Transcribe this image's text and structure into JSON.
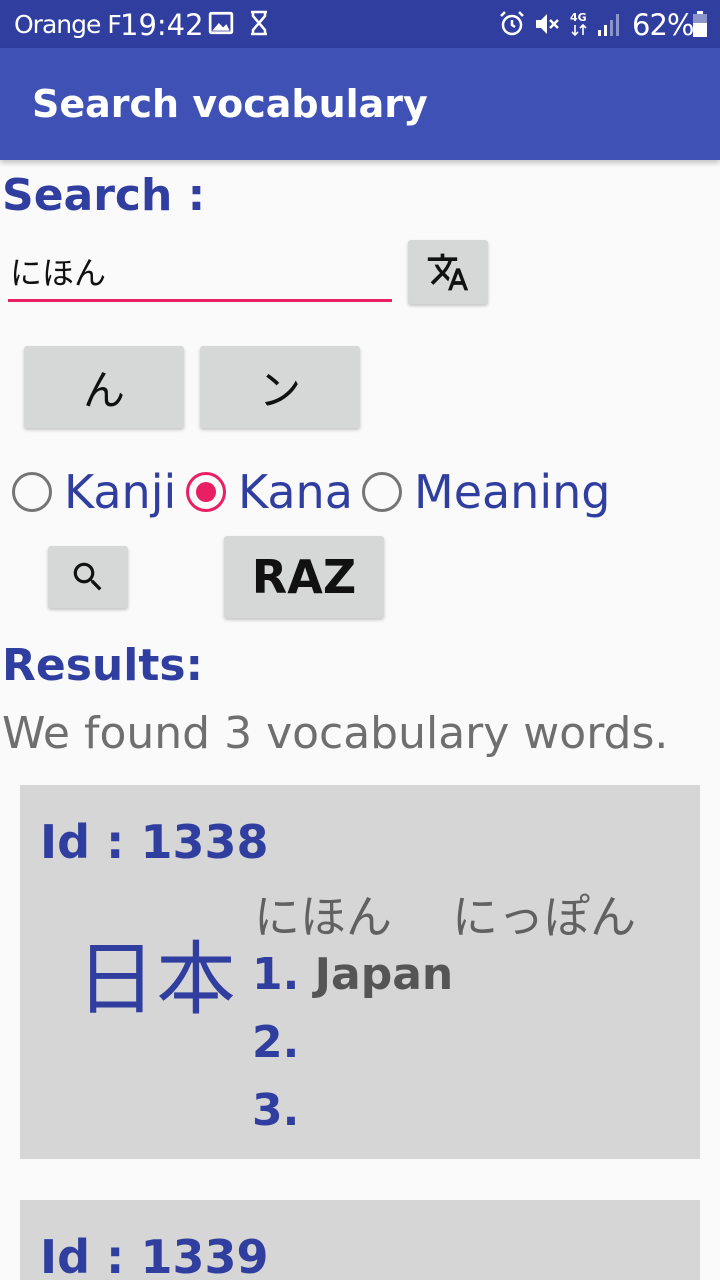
{
  "status_bar": {
    "carrier": "Orange F",
    "time": "19:42",
    "battery": "62%",
    "network": "4G",
    "icons": [
      "image-icon",
      "hourglass-icon",
      "alarm-icon",
      "mute-icon",
      "network-4g-icon",
      "signal-icon",
      "battery-icon"
    ]
  },
  "app_bar": {
    "title": "Search vocabulary"
  },
  "search": {
    "label": "Search :",
    "input_value": "にほん",
    "translate_icon": "translate-icon",
    "hiragana_key": "ん",
    "katakana_key": "ン",
    "modes": [
      {
        "label": "Kanji",
        "checked": false
      },
      {
        "label": "Kana",
        "checked": true
      },
      {
        "label": "Meaning",
        "checked": false
      }
    ],
    "search_icon": "search-icon",
    "reset_label": "RAZ"
  },
  "results": {
    "label": "Results:",
    "summary": "We found 3 vocabulary words.",
    "items": [
      {
        "id_text": "Id : 1338",
        "kanji": "日本",
        "readings": [
          "にほん",
          "にっぽん"
        ],
        "meanings": [
          {
            "num": "1.",
            "text": "Japan"
          },
          {
            "num": "2.",
            "text": ""
          },
          {
            "num": "3.",
            "text": ""
          }
        ]
      },
      {
        "id_text": "Id : 1339"
      }
    ]
  },
  "colors": {
    "status_bar": "#303f9f",
    "app_bar": "#3f51b5",
    "accent": "#e91e63",
    "primary_text": "#303f9f",
    "card_bg": "#d6d6d6"
  }
}
